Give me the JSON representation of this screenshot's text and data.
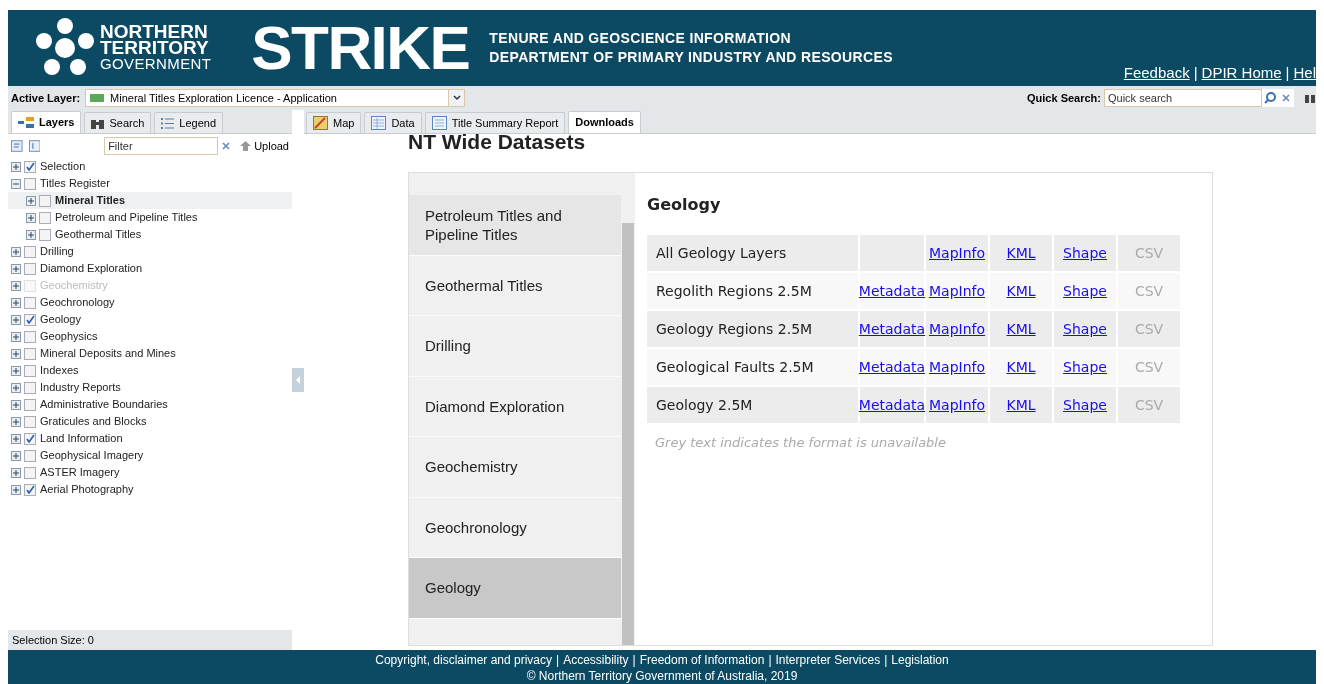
{
  "header": {
    "logo_text": [
      "NORTHERN",
      "TERRITORY",
      "GOVERNMENT"
    ],
    "app_name": "STRIKE",
    "subtitle": [
      "TENURE AND GEOSCIENCE INFORMATION",
      "DEPARTMENT OF PRIMARY INDUSTRY AND RESOURCES"
    ],
    "links": [
      "Feedback",
      "DPIR Home",
      "Hel"
    ],
    "separator": "|"
  },
  "toolbar": {
    "active_layer_label": "Active Layer:",
    "active_layer": "Mineral Titles Exploration Licence - Application",
    "quick_search_label": "Quick Search:",
    "quick_search": {
      "placeholder": "Quick search"
    }
  },
  "left_tabs": [
    {
      "label": "Layers",
      "selected": true
    },
    {
      "label": "Search",
      "selected": false
    },
    {
      "label": "Legend",
      "selected": false
    }
  ],
  "filter": {
    "placeholder": "Filter"
  },
  "upload": "Upload",
  "layers": [
    {
      "label": "Selection",
      "checked": true,
      "expanded": false,
      "disabled": false,
      "selected": false
    },
    {
      "label": "Titles Register",
      "checked": false,
      "expanded": true,
      "disabled": false,
      "selected": false,
      "children": [
        {
          "label": "Mineral Titles",
          "checked": false,
          "expanded": false,
          "disabled": false,
          "selected": true
        },
        {
          "label": "Petroleum and Pipeline Titles",
          "checked": false,
          "expanded": false,
          "disabled": false,
          "selected": false
        },
        {
          "label": "Geothermal Titles",
          "checked": false,
          "expanded": false,
          "disabled": false,
          "selected": false
        }
      ]
    },
    {
      "label": "Drilling",
      "checked": false,
      "expanded": false,
      "disabled": false,
      "selected": false
    },
    {
      "label": "Diamond Exploration",
      "checked": false,
      "expanded": false,
      "disabled": false,
      "selected": false
    },
    {
      "label": "Geochemistry",
      "checked": false,
      "expanded": false,
      "disabled": true,
      "selected": false
    },
    {
      "label": "Geochronology",
      "checked": false,
      "expanded": false,
      "disabled": false,
      "selected": false
    },
    {
      "label": "Geology",
      "checked": true,
      "expanded": false,
      "disabled": false,
      "selected": false
    },
    {
      "label": "Geophysics",
      "checked": false,
      "expanded": false,
      "disabled": false,
      "selected": false
    },
    {
      "label": "Mineral Deposits and Mines",
      "checked": false,
      "expanded": false,
      "disabled": false,
      "selected": false
    },
    {
      "label": "Indexes",
      "checked": false,
      "expanded": false,
      "disabled": false,
      "selected": false
    },
    {
      "label": "Industry Reports",
      "checked": false,
      "expanded": false,
      "disabled": false,
      "selected": false
    },
    {
      "label": "Administrative Boundaries",
      "checked": false,
      "expanded": false,
      "disabled": false,
      "selected": false
    },
    {
      "label": "Graticules and Blocks",
      "checked": false,
      "expanded": false,
      "disabled": false,
      "selected": false
    },
    {
      "label": "Land Information",
      "checked": true,
      "expanded": false,
      "disabled": false,
      "selected": false
    },
    {
      "label": "Geophysical Imagery",
      "checked": false,
      "expanded": false,
      "disabled": false,
      "selected": false
    },
    {
      "label": "ASTER Imagery",
      "checked": false,
      "expanded": false,
      "disabled": false,
      "selected": false
    },
    {
      "label": "Aerial Photography",
      "checked": true,
      "expanded": false,
      "disabled": false,
      "selected": false
    }
  ],
  "selection_size": "Selection Size: 0",
  "main_tabs": [
    {
      "label": "Map",
      "selected": false
    },
    {
      "label": "Data",
      "selected": false
    },
    {
      "label": "Title Summary Report",
      "selected": false
    },
    {
      "label": "Downloads",
      "selected": true
    }
  ],
  "page_title": "NT Wide Datasets",
  "categories": [
    {
      "label": "Petroleum Titles and Pipeline Titles",
      "selected": false
    },
    {
      "label": "Geothermal Titles",
      "selected": false
    },
    {
      "label": "Drilling",
      "selected": false
    },
    {
      "label": "Diamond Exploration",
      "selected": false
    },
    {
      "label": "Geochemistry",
      "selected": false
    },
    {
      "label": "Geochronology",
      "selected": false
    },
    {
      "label": "Geology",
      "selected": true
    }
  ],
  "section_title": "Geology",
  "datasets": [
    {
      "name": "All Geology Layers",
      "links": [
        {
          "label": "MapInfo",
          "available": true
        },
        {
          "label": "KML",
          "available": true
        },
        {
          "label": "Shape",
          "available": true
        },
        {
          "label": "CSV",
          "available": false
        }
      ]
    },
    {
      "name": "Regolith Regions 2.5M",
      "metadata": "Metadata",
      "links": [
        {
          "label": "MapInfo",
          "available": true
        },
        {
          "label": "KML",
          "available": true
        },
        {
          "label": "Shape",
          "available": true
        },
        {
          "label": "CSV",
          "available": false
        }
      ]
    },
    {
      "name": "Geology Regions 2.5M",
      "metadata": "Metadata",
      "links": [
        {
          "label": "MapInfo",
          "available": true
        },
        {
          "label": "KML",
          "available": true
        },
        {
          "label": "Shape",
          "available": true
        },
        {
          "label": "CSV",
          "available": false
        }
      ]
    },
    {
      "name": "Geological Faults 2.5M",
      "metadata": "Metadata",
      "links": [
        {
          "label": "MapInfo",
          "available": true
        },
        {
          "label": "KML",
          "available": true
        },
        {
          "label": "Shape",
          "available": true
        },
        {
          "label": "CSV",
          "available": false
        }
      ]
    },
    {
      "name": "Geology 2.5M",
      "metadata": "Metadata",
      "links": [
        {
          "label": "MapInfo",
          "available": true
        },
        {
          "label": "KML",
          "available": true
        },
        {
          "label": "Shape",
          "available": true
        },
        {
          "label": "CSV",
          "available": false
        }
      ]
    }
  ],
  "note": "Grey text indicates the format is unavailable",
  "footer": {
    "links": [
      "Copyright, disclaimer and privacy",
      "Accessibility",
      "Freedom of Information",
      "Interpreter Services",
      "Legislation"
    ],
    "copyright": "© Northern Territory Government of Australia, 2019",
    "separator": "|"
  }
}
